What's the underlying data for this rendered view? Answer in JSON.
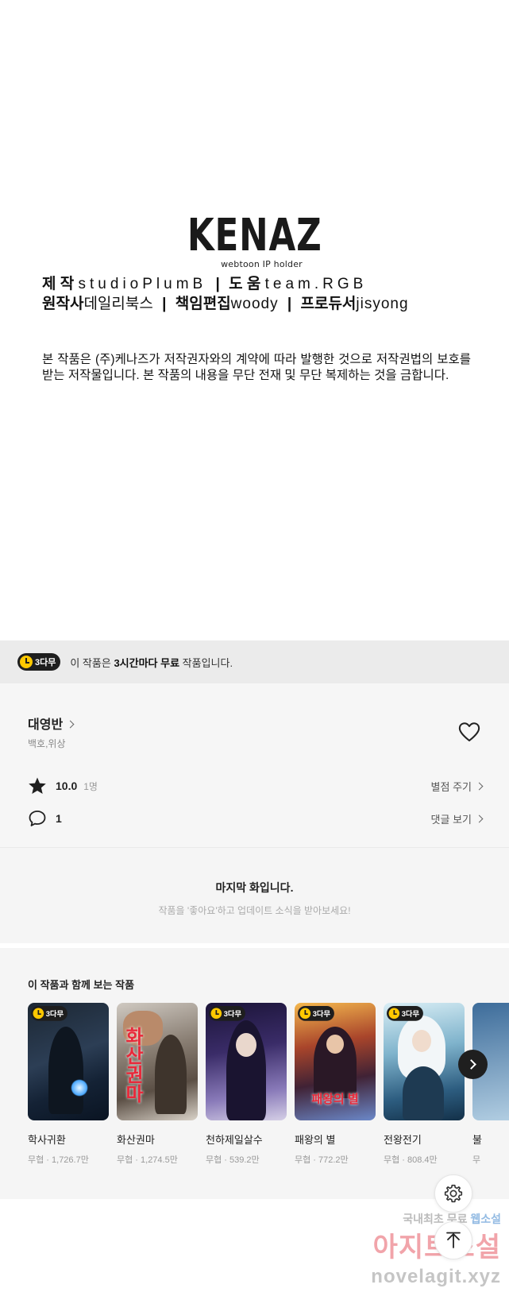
{
  "credits": {
    "logo_text": "KENAZ",
    "logo_subtitle": "webtoon IP holder",
    "line1": [
      {
        "role": "제 작",
        "name": "studioPlumB"
      },
      {
        "role": "도 움",
        "name": "team.RGB"
      }
    ],
    "line2": [
      {
        "role": "원작사",
        "name": "데일리북스"
      },
      {
        "role": "책임편집",
        "name": "woody"
      },
      {
        "role": "프로듀서",
        "name": "jisyong"
      }
    ],
    "separator": "|",
    "notice": "본 작품은 (주)케나즈가 저작권자와의 계약에 따라 발행한 것으로 저작권법의 보호를 받는 저작물입니다. 본 작품의 내용을 무단 전재 및 무단 복제하는 것을 금합니다."
  },
  "banner": {
    "badge": "3다무",
    "text_before": "이 작품은 ",
    "text_bold": "3시간마다 무료",
    "text_after": " 작품입니다."
  },
  "info": {
    "author": "대영반",
    "genre": "백호,위상",
    "rating_value": "10.0",
    "rating_count": "1명",
    "rate_link": "별점 주기",
    "comment_count": "1",
    "comment_link": "댓글 보기"
  },
  "last_episode": {
    "title": "마지막 화입니다.",
    "subtitle": "작품을 '좋아요'하고 업데이트 소식을 받아보세요!"
  },
  "recommendations": {
    "title": "이 작품과 함께 보는 작품",
    "items": [
      {
        "title": "학사귀환",
        "meta": "무협 · 1,726.7만",
        "badge": "3다무",
        "art_title": ""
      },
      {
        "title": "화산권마",
        "meta": "무협 · 1,274.5만",
        "badge": "",
        "art_title": "화산권마"
      },
      {
        "title": "천하제일살수",
        "meta": "무협 · 539.2만",
        "badge": "3다무",
        "art_title": ""
      },
      {
        "title": "패왕의 별",
        "meta": "무협 · 772.2만",
        "badge": "3다무",
        "art_title": "패왕의 별"
      },
      {
        "title": "전왕전기",
        "meta": "무협 · 808.4만",
        "badge": "3다무",
        "art_title": ""
      },
      {
        "title": "불",
        "meta": "무",
        "badge": "",
        "art_title": ""
      }
    ]
  },
  "icons": {
    "settings": "gear-icon",
    "scroll_top": "arrow-up-icon",
    "heart": "heart-icon",
    "star": "star-icon",
    "comment": "comment-icon",
    "next": "chevron-right-icon"
  },
  "watermark": {
    "line1_a": "국내최초 무료 ",
    "line1_b": "웹소설",
    "line2": "아지트소설",
    "line3": "novelagit.xyz"
  }
}
